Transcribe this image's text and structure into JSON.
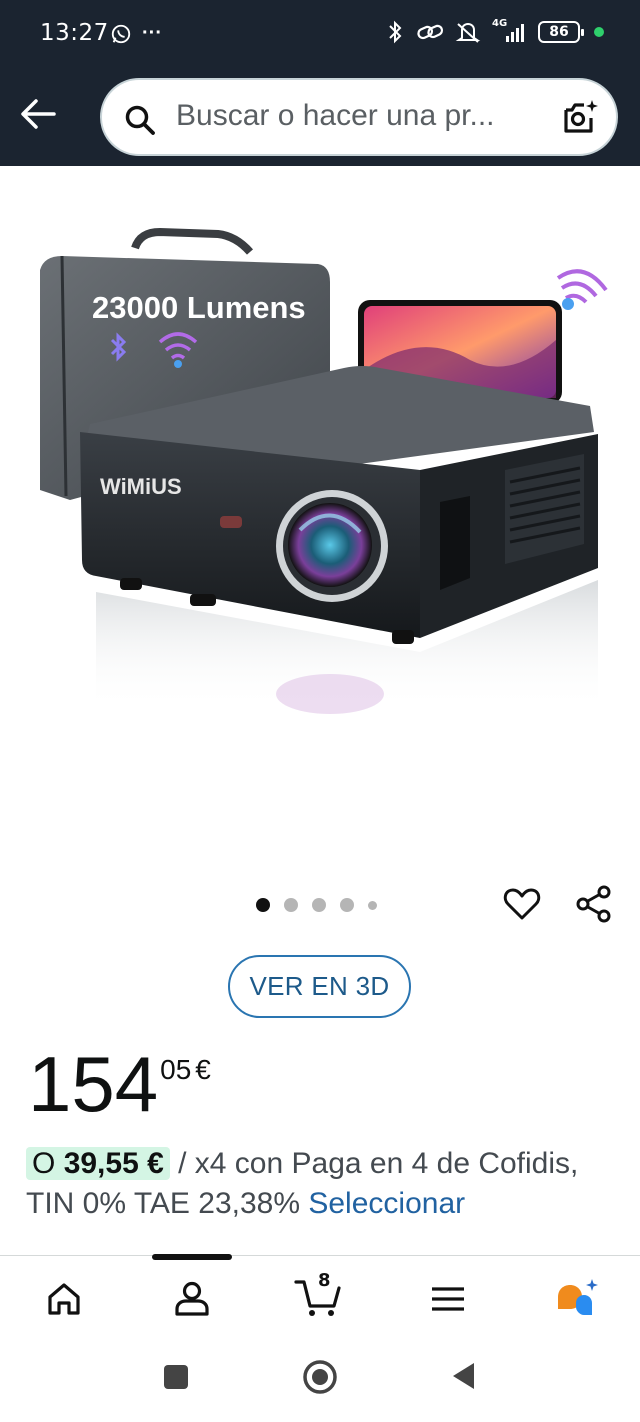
{
  "status_bar": {
    "time": "13:27",
    "more": "···",
    "network": "4G",
    "battery": "86"
  },
  "search": {
    "placeholder": "Buscar o hacer una pr..."
  },
  "product_image": {
    "badge_text": "23000 Lumens",
    "brand_text": "WiMiUS"
  },
  "gallery": {
    "image_count": 5,
    "active_index": 0
  },
  "view_3d_label": "VER EN 3D",
  "price": {
    "whole": "154",
    "fraction": "05",
    "currency": "€"
  },
  "installments": {
    "prefix": "O",
    "amount": "39,55 €",
    "text_1": " / x4 con Paga en 4 de Cofidis,",
    "text_2": " TIN 0% TAE 23,38% ",
    "link": "Seleccionar"
  },
  "bottom_nav": {
    "cart_count": "8"
  },
  "colors": {
    "header_bg": "#1b2430",
    "link": "#2162a1",
    "highlight": "#d4f5e4",
    "accent_orange": "#f08b1d"
  }
}
